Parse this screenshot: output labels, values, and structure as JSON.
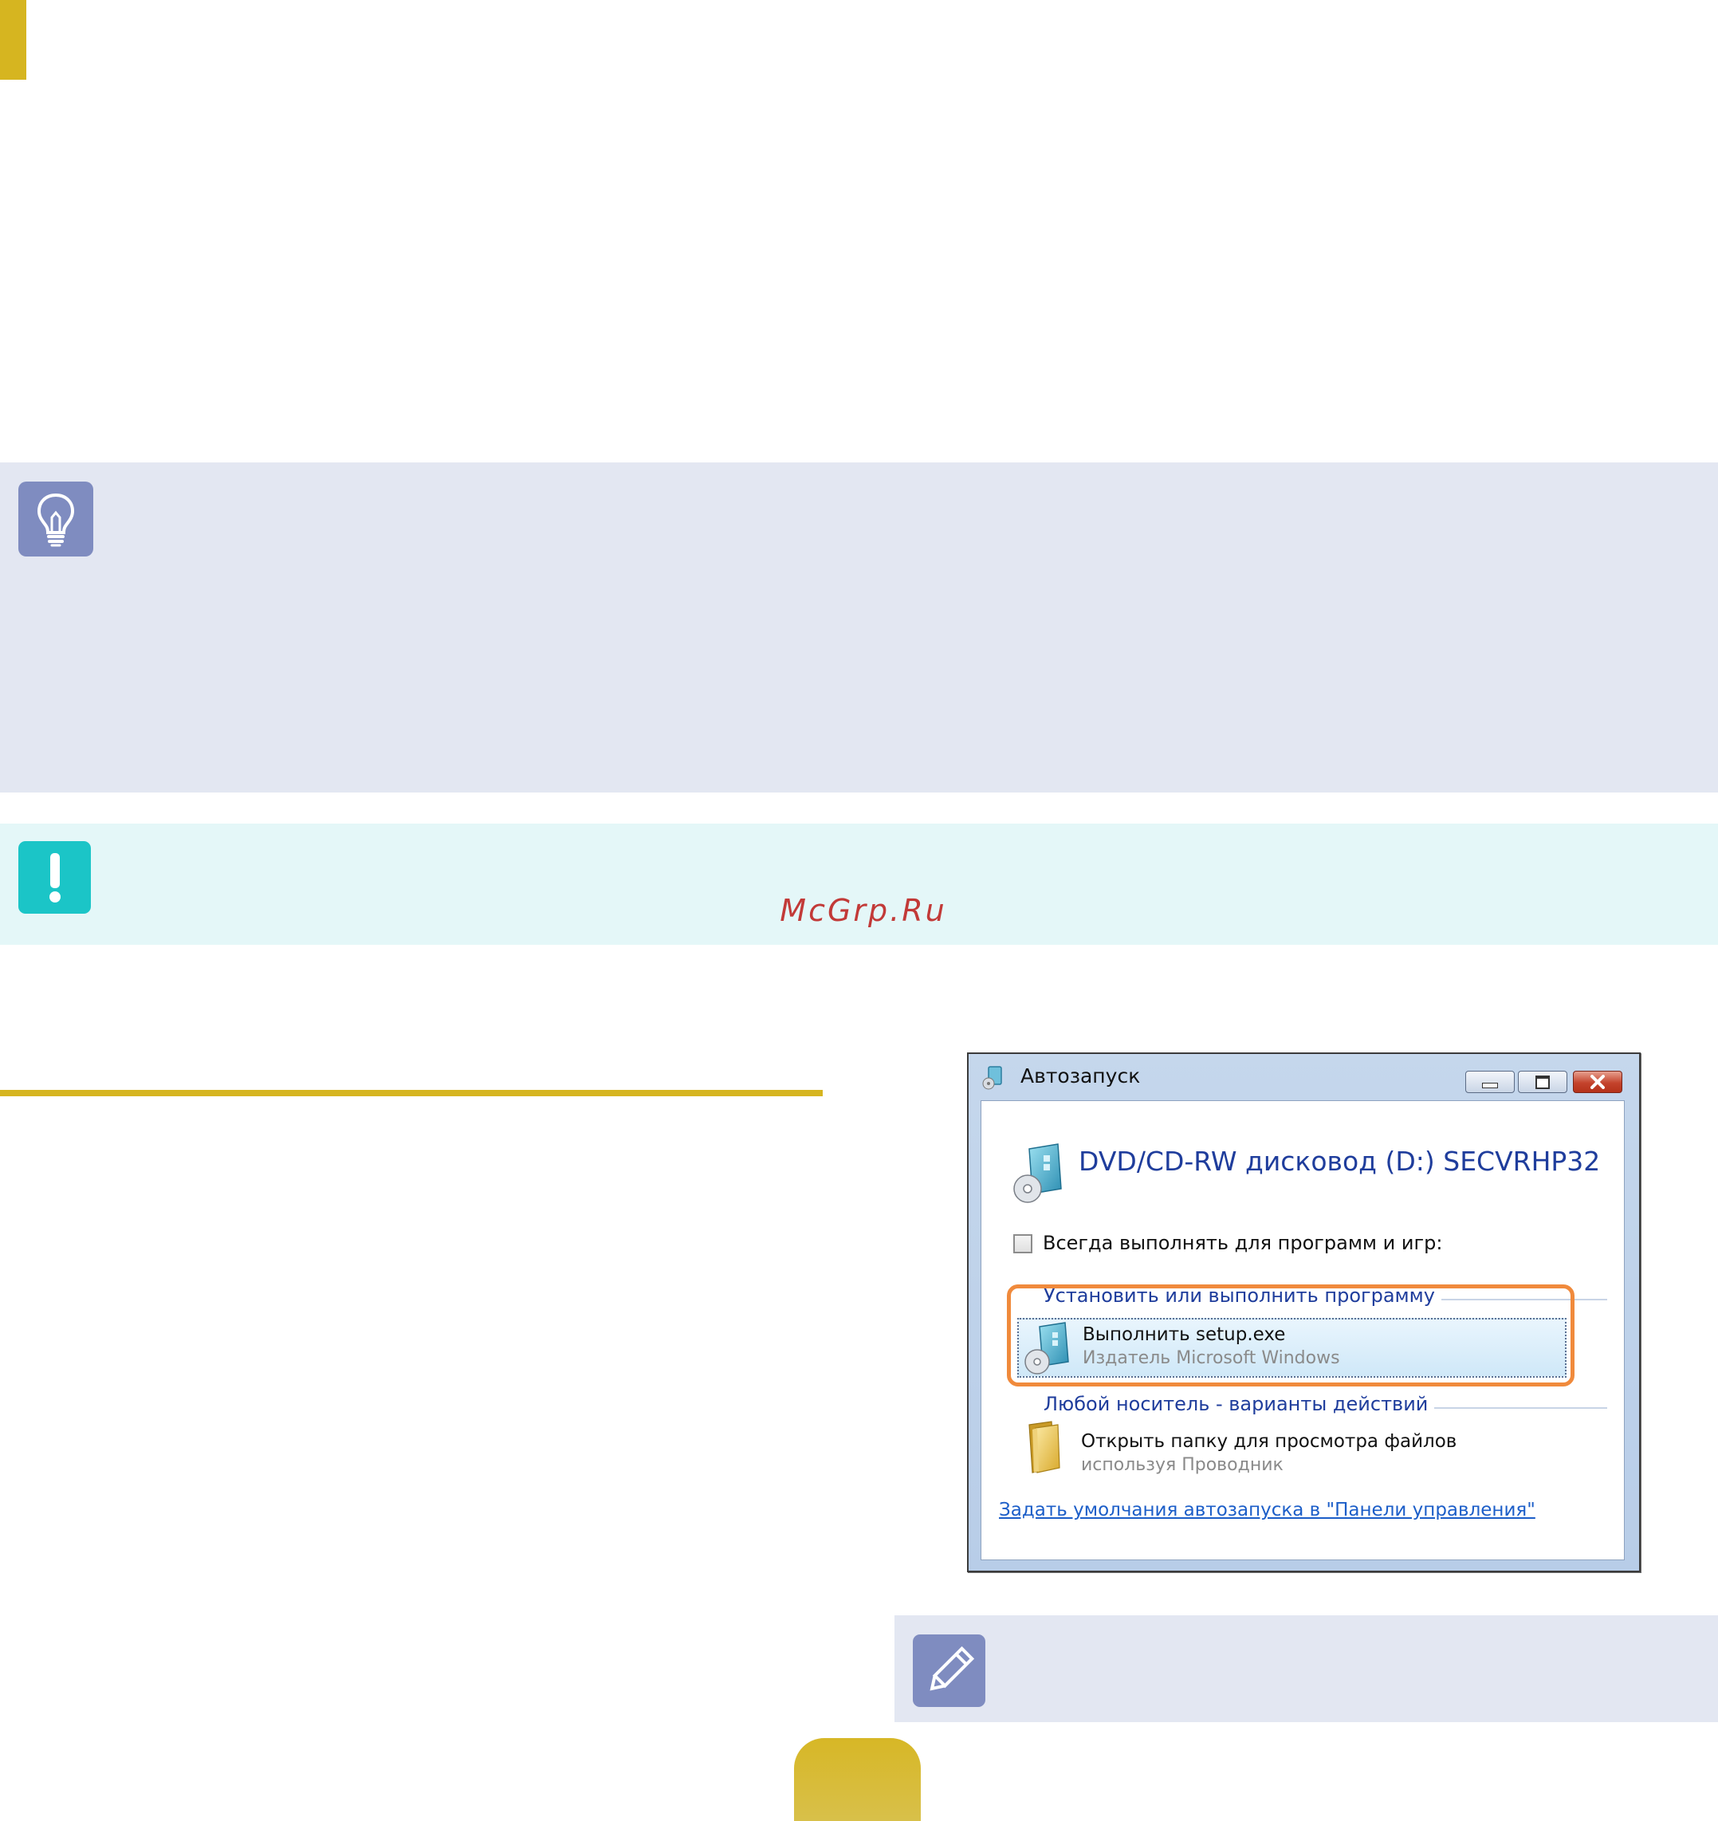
{
  "watermark": "McGrp.Ru",
  "icons": {
    "tip": "lightbulb-icon",
    "warning": "exclamation-icon",
    "note": "pencil-icon"
  },
  "colors": {
    "accent": "#d6b520",
    "tip_background": "#e3e7f2",
    "warning_background": "#e4f7f8",
    "warning_icon": "#1bc5c7",
    "icon_badge": "#7f8cc0",
    "highlight": "#f08a3c",
    "link": "#1c5ec8",
    "dialog_heading": "#1f3d9c"
  },
  "dialog": {
    "title": "Автозапуск",
    "controls": [
      "minimize",
      "maximize",
      "close"
    ],
    "drive_title": "DVD/CD-RW дисковод (D:) SECVRHP32",
    "always_checkbox": {
      "label": "Всегда выполнять для программ и игр:",
      "checked": false
    },
    "install_group": {
      "header": "Установить или выполнить программу",
      "item": {
        "title": "Выполнить setup.exe",
        "subtitle": "Издатель Microsoft Windows",
        "selected": true
      }
    },
    "media_group": {
      "header": "Любой носитель - варианты действий",
      "item": {
        "title": "Открыть папку для просмотра файлов",
        "subtitle": "используя Проводник"
      }
    },
    "defaults_link": "Задать умолчания автозапуска в \"Панели управления\""
  }
}
